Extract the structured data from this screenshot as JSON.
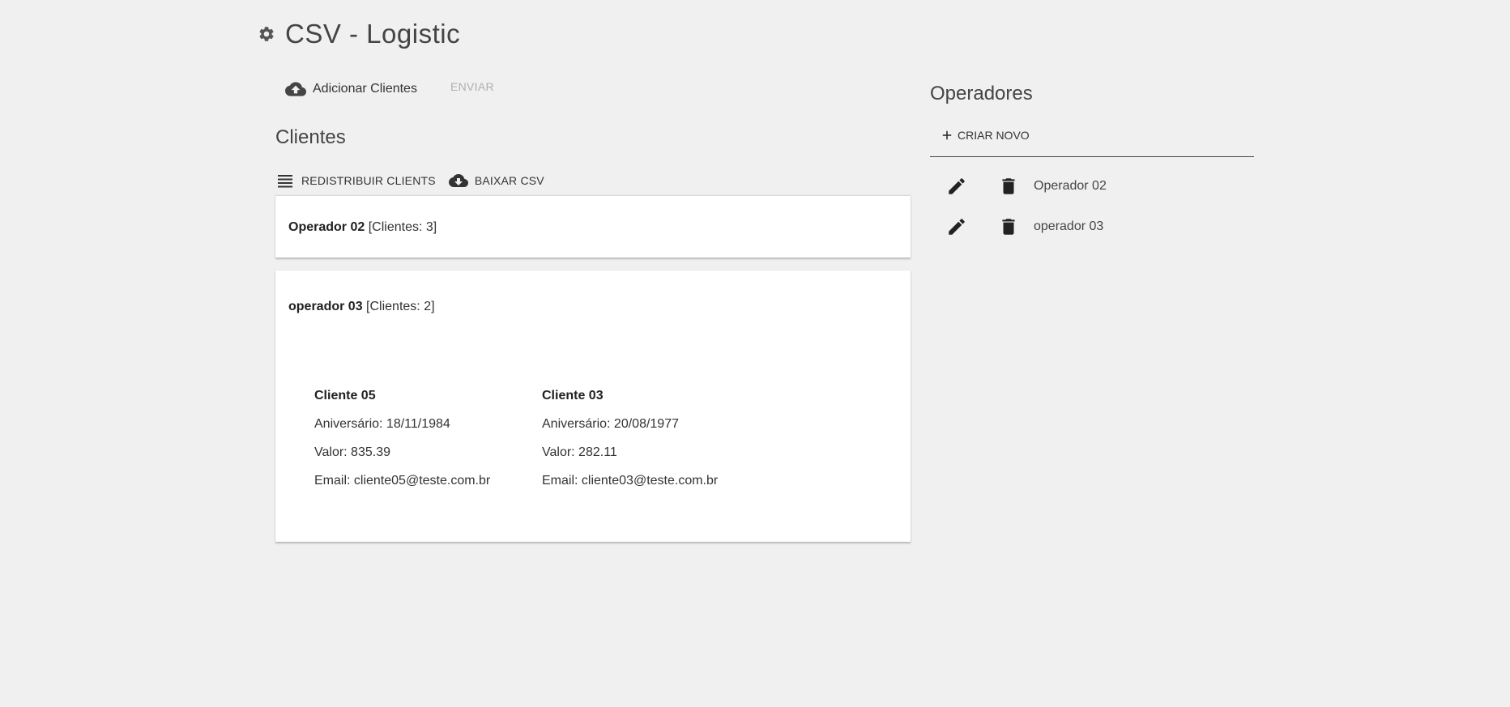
{
  "app": {
    "title": "CSV - Logistic",
    "icon": "gear-icon"
  },
  "upload": {
    "add_clients_label": "Adicionar Clientes",
    "add_clients_icon": "cloud-upload-icon",
    "send_label": "ENVIAR"
  },
  "clientes": {
    "title": "Clientes",
    "toolbar": {
      "redistribute_label": "REDISTRIBUIR CLIENTS",
      "redistribute_icon": "list-lines-icon",
      "download_label": "BAIXAR CSV",
      "download_icon": "cloud-download-icon"
    },
    "groups": [
      {
        "operator": "Operador 02",
        "count_text": "[Clientes: 3]",
        "expanded": false
      },
      {
        "operator": "operador 03",
        "count_text": "[Clientes: 2]",
        "expanded": true,
        "clients": [
          {
            "name": "Cliente 05",
            "birthday": "Aniversário: 18/11/1984",
            "value": "Valor: 835.39",
            "email": "Email: cliente05@teste.com.br"
          },
          {
            "name": "Cliente 03",
            "birthday": "Aniversário: 20/08/1977",
            "value": "Valor: 282.11",
            "email": "Email: cliente03@teste.com.br"
          }
        ]
      }
    ]
  },
  "operadores": {
    "title": "Operadores",
    "create_label": "CRIAR NOVO",
    "create_icon": "plus-icon",
    "items": [
      {
        "name": "Operador 02"
      },
      {
        "name": "operador 03"
      }
    ]
  },
  "colors": {
    "background": "#f0f0f0",
    "panel": "#ffffff",
    "text": "#212121",
    "muted": "#b0b0b0"
  }
}
